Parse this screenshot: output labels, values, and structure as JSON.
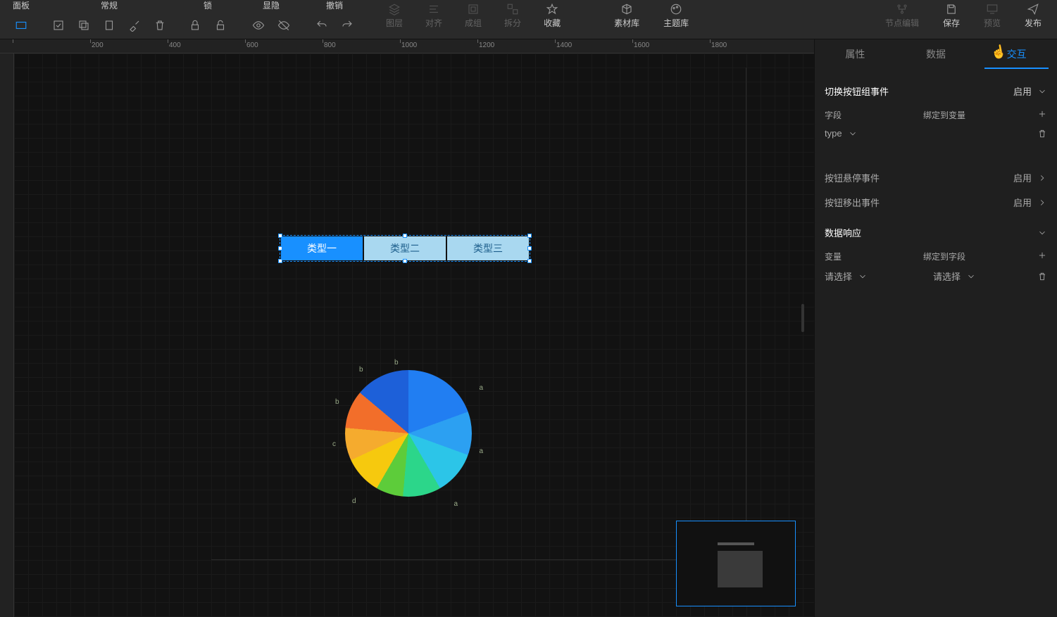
{
  "toolbar_groups": {
    "panel": "面板",
    "general": "常规",
    "lock": "锁",
    "visibility": "显隐",
    "undo": "撤销"
  },
  "toolbar_items": {
    "layers": "图层",
    "align": "对齐",
    "group": "成组",
    "ungroup": "拆分",
    "favorite": "收藏",
    "assets": "素材库",
    "themes": "主题库",
    "node_edit": "节点编辑",
    "save": "保存",
    "preview": "预览",
    "publish": "发布"
  },
  "ruler_marks": [
    "",
    "200",
    "400",
    "600",
    "800",
    "1000",
    "1200",
    "1400",
    "1600",
    "1800"
  ],
  "button_group": {
    "items": [
      "类型一",
      "类型二",
      "类型三"
    ],
    "active_index": 0
  },
  "chart_data": {
    "type": "pie",
    "title": "",
    "series": [
      {
        "name": "a",
        "value": 19
      },
      {
        "name": "a",
        "value": 11
      },
      {
        "name": "a",
        "value": 11
      },
      {
        "name": "d",
        "value": 10
      },
      {
        "name": "c",
        "value": 7
      },
      {
        "name": "b",
        "value": 10
      },
      {
        "name": "b",
        "value": 8
      },
      {
        "name": "b",
        "value": 10
      },
      {
        "name": "a",
        "value": 14
      }
    ],
    "colors": [
      "#217ef2",
      "#2ca0f2",
      "#2cc5e8",
      "#2cd68a",
      "#5dcc3a",
      "#f6c90e",
      "#f5ab2e",
      "#f26e2a",
      "#1d60d9"
    ]
  },
  "panel": {
    "tabs": {
      "attrs": "属性",
      "data": "数据",
      "interact": "交互"
    },
    "active_tab": "interact",
    "section1": {
      "title": "切换按钮组事件",
      "status": "启用",
      "field_label": "字段",
      "bind_label": "绑定到变量",
      "field_value": "type"
    },
    "hover_event": {
      "label": "按钮悬停事件",
      "status": "启用"
    },
    "out_event": {
      "label": "按钮移出事件",
      "status": "启用"
    },
    "data_response": {
      "title": "数据响应",
      "var_label": "变量",
      "bind_field_label": "绑定到字段",
      "var_placeholder": "请选择",
      "field_placeholder": "请选择"
    }
  }
}
